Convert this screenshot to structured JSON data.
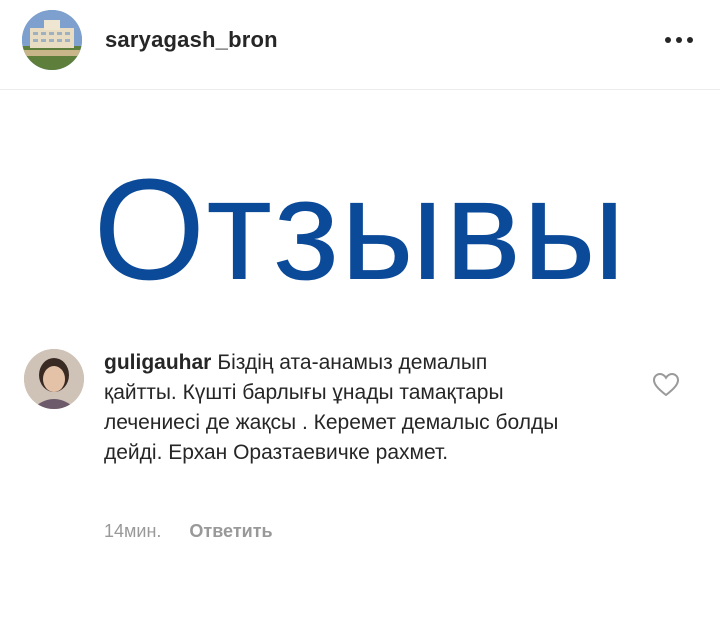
{
  "post": {
    "username": "saryagash_bron",
    "more_icon": "more-horizontal-icon",
    "hero_text": "Отзывы"
  },
  "comment": {
    "username": "guligauhar",
    "text": "Біздің ата-анамыз демалып қайтты. Күшті барлығы ұнады тамақтары лечениесі де жақсы . Керемет демалыс болды дейді. Ерхан Оразтаевичке рахмет.",
    "time": "14мин.",
    "reply_label": "Ответить",
    "like_icon": "heart-outline-icon"
  },
  "colors": {
    "hero": "#0b4a98",
    "text": "#262626",
    "muted": "#999999",
    "divider": "#ececec"
  }
}
